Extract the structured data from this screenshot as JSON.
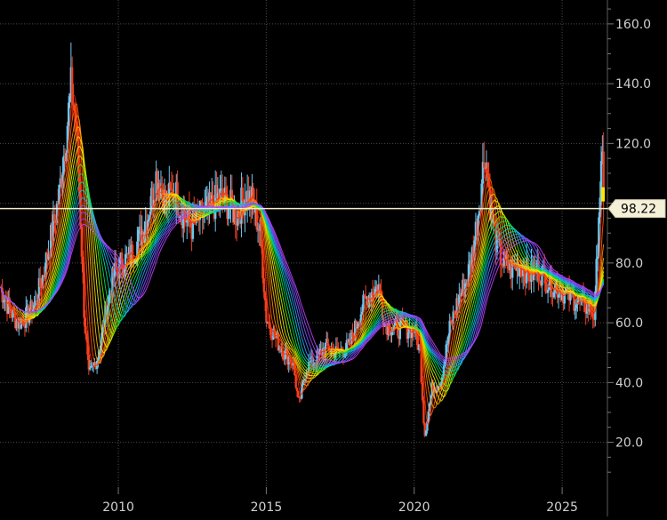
{
  "chart_data": {
    "type": "line",
    "title": "",
    "xlabel": "",
    "ylabel": "",
    "xlim": [
      2006.0,
      2026.5
    ],
    "ylim": [
      5,
      168
    ],
    "x_ticks": [
      2010,
      2015,
      2020,
      2025
    ],
    "x_tick_labels": [
      "2010",
      "2015",
      "2020",
      "2025"
    ],
    "y_ticks": [
      20,
      40,
      60,
      80,
      100,
      120,
      140,
      160
    ],
    "y_tick_labels": [
      "20.0",
      "40.0",
      "60.0",
      "80.0",
      "",
      "120.0",
      "140.0",
      "160.0"
    ],
    "grid": true,
    "last_price": {
      "value": 98.22,
      "label": "98.22"
    },
    "colors": {
      "background": "#000000",
      "grid": "#4a4a4a",
      "axis_text": "#d0d0d0",
      "price_line": "#f2ecc8",
      "price_tag_bg": "#f5f0d8",
      "candle_up": "#6ec6ee",
      "candle_down": "#f04020",
      "rainbow": [
        "#ff2a00",
        "#ff5a00",
        "#ff8a00",
        "#ffb400",
        "#ffd800",
        "#f0f000",
        "#b4f000",
        "#66e800",
        "#00e050",
        "#00d8a0",
        "#00c8d8",
        "#30a0ff",
        "#5878ff",
        "#7858ff",
        "#9a40ff",
        "#c040ff"
      ]
    },
    "price_series": {
      "x": [
        2006.0,
        2006.3,
        2006.6,
        2006.9,
        2007.2,
        2007.5,
        2007.8,
        2008.0,
        2008.2,
        2008.4,
        2008.55,
        2008.7,
        2008.85,
        2009.0,
        2009.15,
        2009.35,
        2009.6,
        2009.85,
        2010.1,
        2010.4,
        2010.7,
        2011.0,
        2011.3,
        2011.6,
        2011.9,
        2012.2,
        2012.5,
        2012.8,
        2013.1,
        2013.4,
        2013.7,
        2014.0,
        2014.3,
        2014.55,
        2014.8,
        2015.0,
        2015.3,
        2015.6,
        2015.9,
        2016.1,
        2016.35,
        2016.7,
        2017.0,
        2017.4,
        2017.8,
        2018.2,
        2018.5,
        2018.8,
        2019.0,
        2019.3,
        2019.7,
        2020.0,
        2020.2,
        2020.35,
        2020.6,
        2020.9,
        2021.2,
        2021.5,
        2021.8,
        2022.0,
        2022.2,
        2022.4,
        2022.6,
        2022.8,
        2023.0,
        2023.3,
        2023.6,
        2023.9,
        2024.2,
        2024.5,
        2024.8,
        2025.1,
        2025.4,
        2025.7,
        2025.95,
        2026.1,
        2026.25,
        2026.35,
        2026.4
      ],
      "values": [
        72,
        65,
        60,
        62,
        66,
        78,
        92,
        103,
        120,
        138,
        130,
        100,
        62,
        42,
        45,
        50,
        65,
        76,
        80,
        82,
        88,
        96,
        110,
        100,
        104,
        96,
        92,
        96,
        98,
        102,
        100,
        96,
        103,
        100,
        90,
        62,
        55,
        50,
        47,
        32,
        45,
        48,
        52,
        50,
        52,
        64,
        70,
        72,
        60,
        58,
        58,
        58,
        50,
        22,
        38,
        40,
        58,
        68,
        75,
        85,
        100,
        118,
        96,
        86,
        80,
        78,
        80,
        76,
        78,
        74,
        72,
        70,
        68,
        66,
        65,
        62,
        100,
        114,
        98
      ]
    },
    "moving_average_count": 16
  }
}
